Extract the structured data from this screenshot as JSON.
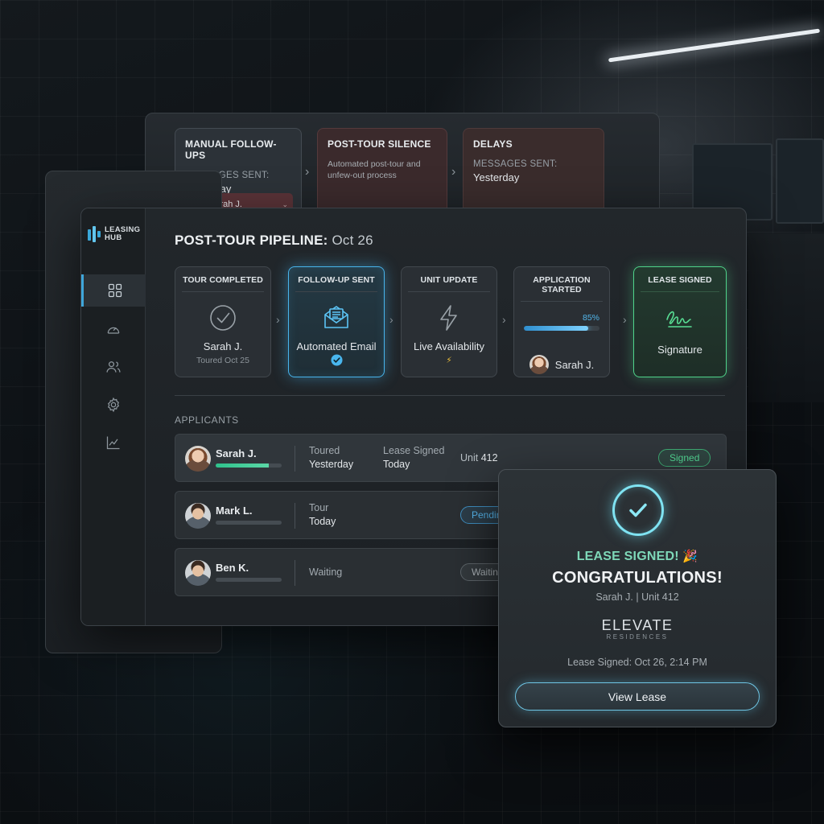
{
  "background_stack": {
    "steps": [
      {
        "title": "MANUAL FOLLOW-UPS",
        "label": "MESSAGES SENT:",
        "value": "Yesterday",
        "chip_name": "Sarah J."
      },
      {
        "title": "POST-TOUR SILENCE",
        "description": "Automated post-tour and unfew-out process"
      },
      {
        "title": "DELAYS",
        "label": "MESSAGES SENT:",
        "value": "Yesterday"
      }
    ]
  },
  "app": {
    "logo": "LEASING HUB",
    "nav": [
      "dashboard-icon",
      "speedometer-icon",
      "users-icon",
      "gear-icon",
      "analytics-icon"
    ]
  },
  "pipeline": {
    "title": "POST-TOUR PIPELINE:",
    "date": "Oct 26",
    "steps": [
      {
        "title": "TOUR COMPLETED",
        "main": "Sarah J.",
        "sub": "Toured Oct 25",
        "icon": "check-circle-icon"
      },
      {
        "title": "FOLLOW-UP SENT",
        "main": "Automated Email",
        "icon": "envelope-icon",
        "state": "focused"
      },
      {
        "title": "UNIT UPDATE",
        "main": "Live Availability",
        "sub": "⚡",
        "icon": "lightning-icon"
      },
      {
        "title": "APPLICATION STARTED",
        "progress_percent": 85,
        "progress_label": "85%",
        "person": "Sarah J."
      },
      {
        "title": "LEASE SIGNED",
        "main": "Signature",
        "icon": "signature-icon",
        "state": "done"
      }
    ]
  },
  "applicants": {
    "label": "APPLICANTS",
    "rows": [
      {
        "name": "Sarah J.",
        "progress": 0.8,
        "f1_label": "Toured",
        "f1_value": "Yesterday",
        "f2_label": "Lease Signed",
        "f2_value": "Today",
        "unit_label": "Unit",
        "unit_value": "412",
        "status": "Signed"
      },
      {
        "name": "Mark L.",
        "progress": 0.0,
        "f1_label": "Tour",
        "f1_value": "Today",
        "status": "Pendin"
      },
      {
        "name": "Ben K.",
        "progress": 0.0,
        "f1_label": "Waiting",
        "status": "Waitin"
      }
    ]
  },
  "modal": {
    "kicker": "LEASE SIGNED!",
    "kicker_emoji": "🎉",
    "title": "CONGRATULATIONS!",
    "subtitle": "Sarah J. | Unit 412",
    "brand": "ELEVATE",
    "brand_sub": "RESIDENCES",
    "timestamp": "Lease Signed: Oct 26, 2:14 PM",
    "button_label": "View Lease"
  },
  "colors": {
    "accent_blue": "#48b4ec",
    "accent_green": "#4fd38a",
    "accent_cyan": "#7fe3f2"
  }
}
